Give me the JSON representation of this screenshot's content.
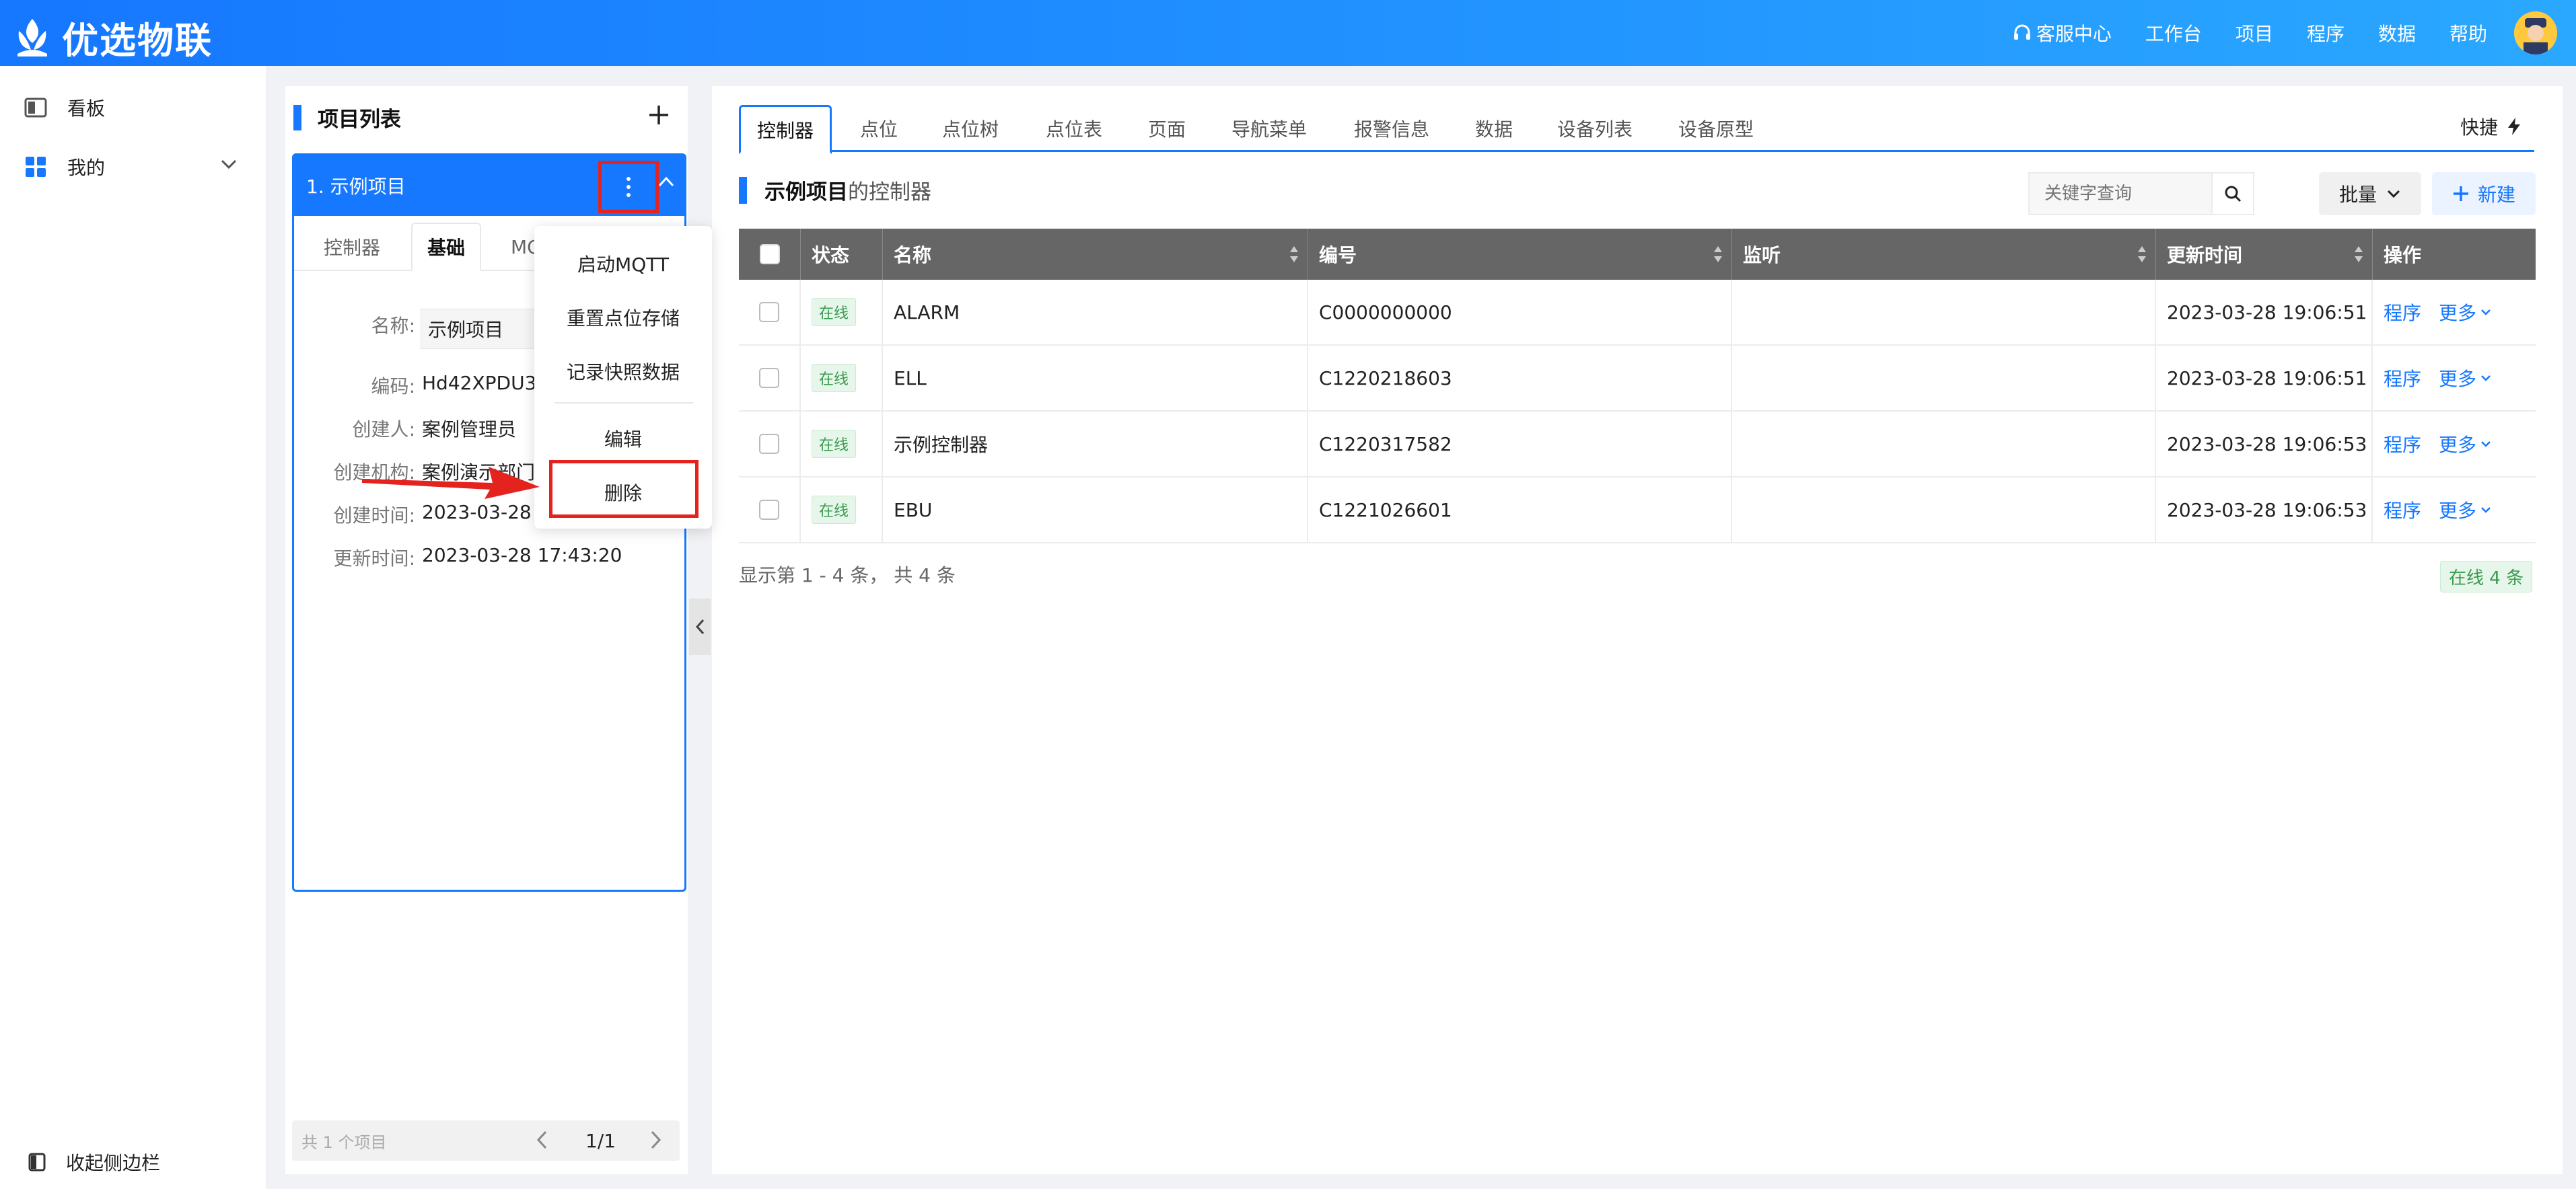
{
  "app": {
    "brand": "优选物联"
  },
  "topnav": {
    "service": "客服中心",
    "workbench": "工作台",
    "project": "项目",
    "program": "程序",
    "data": "数据",
    "help": "帮助"
  },
  "sidebar": {
    "items": [
      {
        "label": "看板",
        "icon": "board-icon"
      },
      {
        "label": "我的",
        "icon": "grid-icon"
      }
    ],
    "collapse_label": "收起侧边栏"
  },
  "project_panel": {
    "title": "项目列表",
    "project_name": "1. 示例项目",
    "tabs": [
      "控制器",
      "基础",
      "MQTT"
    ],
    "info": {
      "name_label": "名称",
      "name_value": "示例项目",
      "code_label": "编码",
      "code_value": "Hd42XPDU3",
      "creator_label": "创建人",
      "creator_value": "案例管理员",
      "org_label": "创建机构",
      "org_value": "案例演示部门",
      "created_label": "创建时间",
      "created_value": "2023-03-28",
      "updated_label": "更新时间",
      "updated_value": "2023-03-28 17:43:20"
    },
    "pager": {
      "total": "共 1 个项目",
      "page": "1/1"
    }
  },
  "context_menu": {
    "items": [
      "启动MQTT",
      "重置点位存储",
      "记录快照数据",
      "编辑",
      "删除"
    ]
  },
  "main": {
    "tabs": [
      "控制器",
      "点位",
      "点位树",
      "点位表",
      "页面",
      "导航菜单",
      "报警信息",
      "数据",
      "设备列表",
      "设备原型"
    ],
    "quick": "快捷",
    "section_title": "示例项目",
    "section_suffix": "的控制器",
    "search_placeholder": "关键字查询",
    "batch": "批量",
    "new": "新建",
    "columns": [
      "状态",
      "名称",
      "编号",
      "监听",
      "更新时间",
      "操作"
    ],
    "rows": [
      {
        "status": "在线",
        "name": "ALARM",
        "code": "C0000000000",
        "listen": "",
        "updated": "2023-03-28 19:06:51",
        "op1": "程序",
        "op2": "更多"
      },
      {
        "status": "在线",
        "name": "ELL",
        "code": "C1220218603",
        "listen": "",
        "updated": "2023-03-28 19:06:51",
        "op1": "程序",
        "op2": "更多"
      },
      {
        "status": "在线",
        "name": "示例控制器",
        "code": "C1220317582",
        "listen": "",
        "updated": "2023-03-28 19:06:53",
        "op1": "程序",
        "op2": "更多"
      },
      {
        "status": "在线",
        "name": "EBU",
        "code": "C1221026601",
        "listen": "",
        "updated": "2023-03-28 19:06:53",
        "op1": "程序",
        "op2": "更多"
      }
    ],
    "summary": "显示第 1 - 4 条， 共 4 条",
    "online_count": "在线 4 条"
  },
  "colors": {
    "accent": "#1677ff",
    "highlight": "#e4221e",
    "online": "#3a9a4f"
  }
}
